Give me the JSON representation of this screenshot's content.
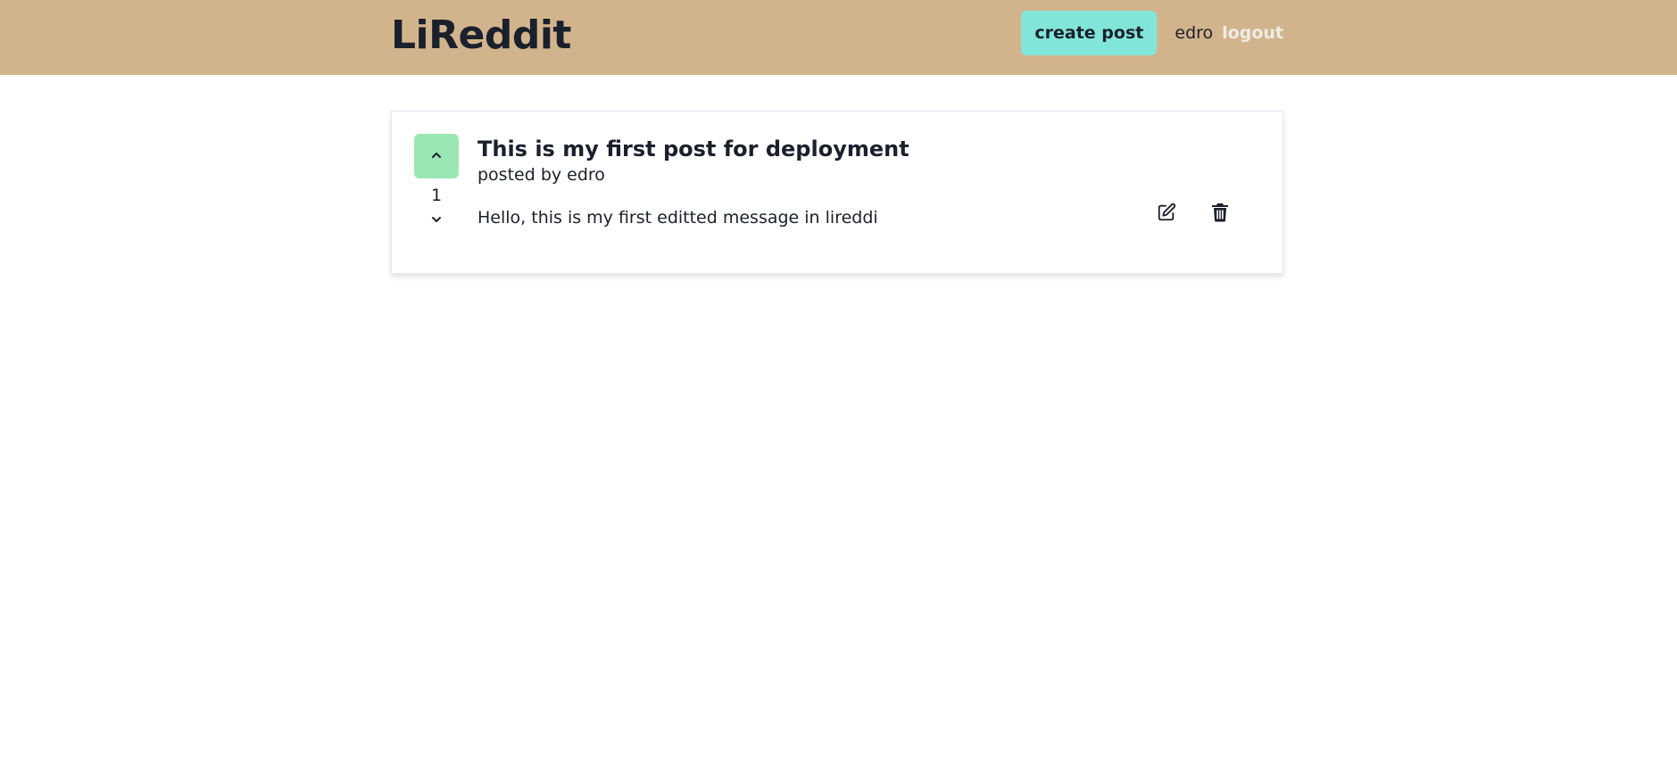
{
  "navbar": {
    "brand": "LiReddit",
    "create_post_label": "create post",
    "username": "edro",
    "logout_label": "logout",
    "background_color": "#d2b48c",
    "create_button_color": "#81e6d9"
  },
  "post": {
    "score": "1",
    "title": "This is my first post for deployment",
    "author_line": "posted by edro",
    "text": "Hello, this is my first editted message in lireddi",
    "upvote_color": "#9ae6b4",
    "icons": {
      "upvote": "chevron-up-icon",
      "downvote": "chevron-down-icon",
      "edit": "edit-icon",
      "delete": "trash-icon"
    }
  }
}
